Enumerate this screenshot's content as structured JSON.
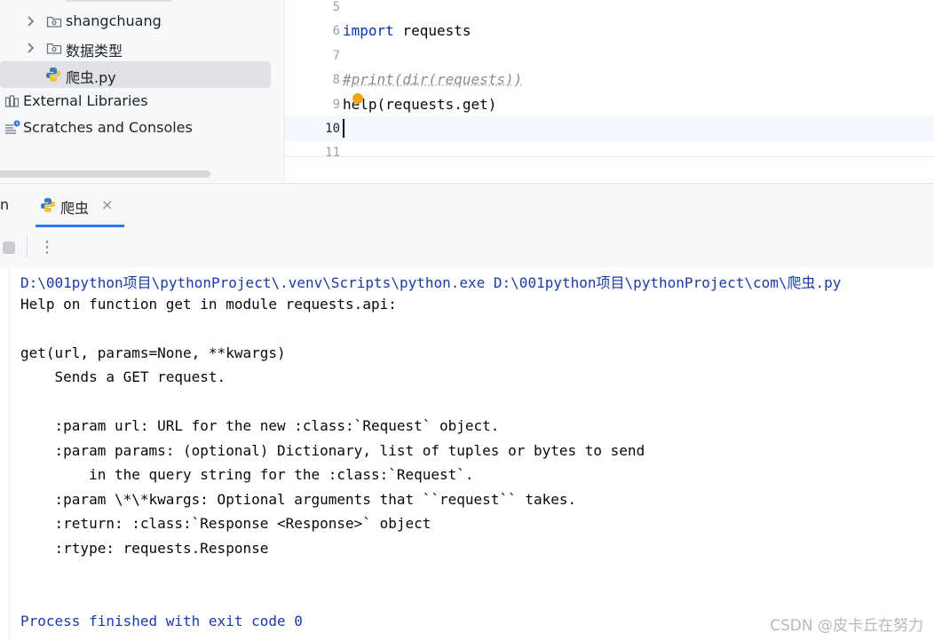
{
  "project_tree": {
    "items": [
      {
        "label": "shangchuang",
        "type": "folder"
      },
      {
        "label": "数据类型",
        "type": "folder"
      },
      {
        "label": "爬虫.py",
        "type": "python-file"
      },
      {
        "label": "External Libraries",
        "type": "library"
      },
      {
        "label": "Scratches and Consoles",
        "type": "scratches"
      }
    ]
  },
  "editor": {
    "line_numbers": [
      "5",
      "6",
      "7",
      "8",
      "9",
      "10",
      "11"
    ],
    "current_line": "10",
    "code": {
      "line6_keyword": "import",
      "line6_rest": " requests",
      "line8_comment": "#print(dir(requests))",
      "line9": "help(requests.get)"
    }
  },
  "run_window": {
    "tab_label": "爬虫",
    "tab_close": "×",
    "more_icon_glyph": "⋮",
    "partial_tab_text": "n",
    "console_lines": [
      "D:\\001python项目\\pythonProject\\.venv\\Scripts\\python.exe D:\\001python项目\\pythonProject\\com\\爬虫.py",
      "Help on function get in module requests.api:",
      "",
      "get(url, params=None, **kwargs)",
      "    Sends a GET request.",
      "",
      "    :param url: URL for the new :class:`Request` object.",
      "    :param params: (optional) Dictionary, list of tuples or bytes to send",
      "        in the query string for the :class:`Request`.",
      "    :param \\*\\*kwargs: Optional arguments that ``request`` takes.",
      "    :return: :class:`Response <Response>` object",
      "    :rtype: requests.Response",
      "",
      "",
      "Process finished with exit code 0"
    ]
  },
  "watermark": "CSDN @皮卡丘在努力",
  "colors": {
    "keyword": "#0033b3",
    "comment": "#8c8c8c",
    "selection_bg": "#dfe1e5",
    "tab_accent": "#3574f0",
    "system_output": "#1a3aa8",
    "bulb": "#f2a516"
  }
}
